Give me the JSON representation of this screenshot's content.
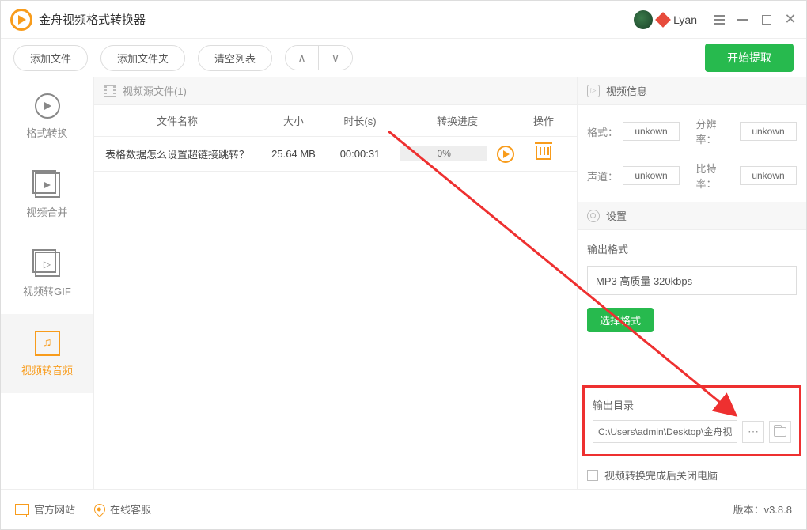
{
  "app": {
    "title": "金舟视频格式转换器"
  },
  "user": {
    "name": "Lyan"
  },
  "toolbar": {
    "add_file": "添加文件",
    "add_folder": "添加文件夹",
    "clear_list": "清空列表",
    "extract": "开始提取"
  },
  "sidebar": {
    "format_convert": "格式转换",
    "video_merge": "视频合并",
    "video_to_gif": "视频转GIF",
    "video_to_audio": "视频转音频"
  },
  "file_panel": {
    "header": "视频源文件(1)",
    "columns": {
      "name": "文件名称",
      "size": "大小",
      "duration": "时长(s)",
      "progress": "转换进度",
      "operation": "操作"
    },
    "rows": [
      {
        "name": "表格数据怎么设置超链接跳转？",
        "size": "25.64 MB",
        "duration": "00:00:31",
        "progress": "0%"
      }
    ]
  },
  "info_panel": {
    "header": "视频信息",
    "format_label": "格式：",
    "format_value": "unkown",
    "resolution_label": "分辨率：",
    "resolution_value": "unkown",
    "channel_label": "声道：",
    "channel_value": "unkown",
    "bitrate_label": "比特率：",
    "bitrate_value": "unkown"
  },
  "settings_panel": {
    "header": "设置",
    "output_format_label": "输出格式",
    "output_format_value": "MP3 高质量 320kbps",
    "choose_format_btn": "选择格式",
    "output_dir_label": "输出目录",
    "output_dir_value": "C:\\Users\\admin\\Desktop\\金舟视",
    "shutdown_checkbox": "视频转换完成后关闭电脑"
  },
  "footer": {
    "official_site": "官方网站",
    "online_service": "在线客服",
    "version": "版本：v3.8.8"
  }
}
